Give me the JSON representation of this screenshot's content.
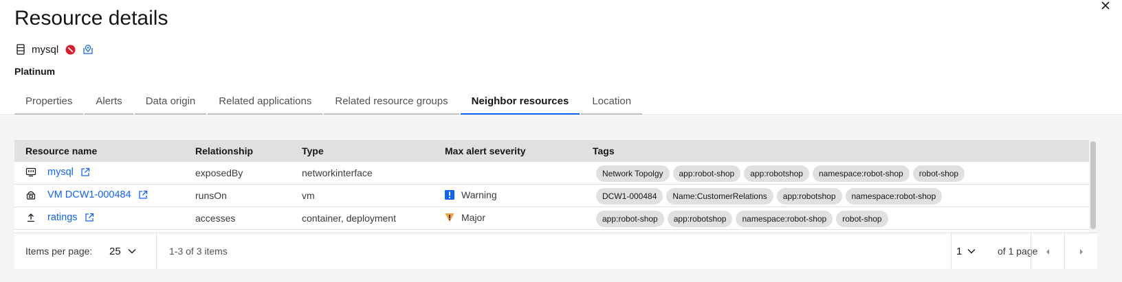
{
  "panel": {
    "title": "Resource details",
    "resource_name": "mysql",
    "tier": "Platinum"
  },
  "tabs": [
    {
      "label": "Properties"
    },
    {
      "label": "Alerts"
    },
    {
      "label": "Data origin"
    },
    {
      "label": "Related applications"
    },
    {
      "label": "Related resource groups"
    },
    {
      "label": "Neighbor resources",
      "active": true
    },
    {
      "label": "Location"
    }
  ],
  "table": {
    "headers": {
      "name": "Resource name",
      "relationship": "Relationship",
      "type": "Type",
      "severity": "Max alert severity",
      "tags": "Tags"
    },
    "rows": [
      {
        "icon": "network-interface-icon",
        "name": "mysql",
        "relationship": "exposedBy",
        "type": "networkinterface",
        "severity": "",
        "tags": [
          "Network Topolgy",
          "app:robot-shop",
          "app:robotshop",
          "namespace:robot-shop",
          "robot-shop"
        ]
      },
      {
        "icon": "virtual-machine-icon",
        "name": "VM DCW1-000484",
        "relationship": "runsOn",
        "type": "vm",
        "severity": "Warning",
        "tags": [
          "DCW1-000484",
          "Name:CustomerRelations",
          "app:robotshop",
          "namespace:robot-shop"
        ]
      },
      {
        "icon": "upload-icon",
        "name": "ratings",
        "relationship": "accesses",
        "type": "container, deployment",
        "severity": "Major",
        "tags": [
          "app:robot-shop",
          "app:robotshop",
          "namespace:robot-shop",
          "robot-shop"
        ]
      }
    ]
  },
  "pagination": {
    "items_per_page_label": "Items per page:",
    "items_per_page": "25",
    "range_text": "1-3 of 3 items",
    "page": "1",
    "of_pages": "of 1 page"
  },
  "colors": {
    "link": "#0f62fe",
    "active_tab": "#0f62fe",
    "warning": "#0f62fe",
    "major": "#f1a23a",
    "blocked": "#da1e28"
  }
}
